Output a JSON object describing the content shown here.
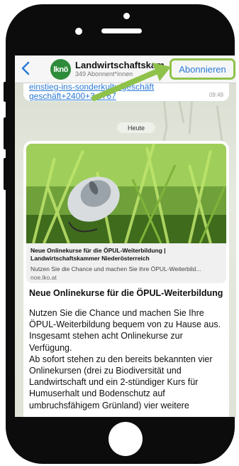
{
  "channel": {
    "avatar_text": "lknö",
    "name": "Landwirtschaftskam..",
    "subscribers": "349 Abonnent*innen",
    "subscribe_label": "Abonnieren"
  },
  "previous_message": {
    "link_line1": "einstieg-ins-sonderkulturgeschäft",
    "link_line2": "geschäft+2400+3...767",
    "time": "09:49"
  },
  "date_separator": "Heute",
  "link_preview": {
    "title": "Neue Onlinekurse für die ÖPUL-Weiterbildung | Landwirtschaftskammer Niederösterreich",
    "description": "Nutzen Sie die Chance und machen Sie ihre ÖPUL-Weiterbild...",
    "domain": "noe.lko.at"
  },
  "message": {
    "title": "Neue Onlinekurse für die ÖPUL-Weiterbildung",
    "para1": "Nutzen Sie die Chance und machen Sie Ihre ÖPUL-Weiterbildung bequem von zu Hause aus. Insgesamt stehen acht Onlinekurse zur Verfügung.",
    "para2": "Ab sofort stehen zu den bereits bekannten vier Onlinekursen (drei zu Biodiversität und Landwirtschaft und ein 2-stündiger Kurs für Humuserhalt und Bodenschutz auf umbruchsfähigem Grünland) vier weitere"
  },
  "colors": {
    "accent": "#2a7ad6",
    "highlight": "#8fc24a",
    "avatar": "#2e8b3a"
  }
}
